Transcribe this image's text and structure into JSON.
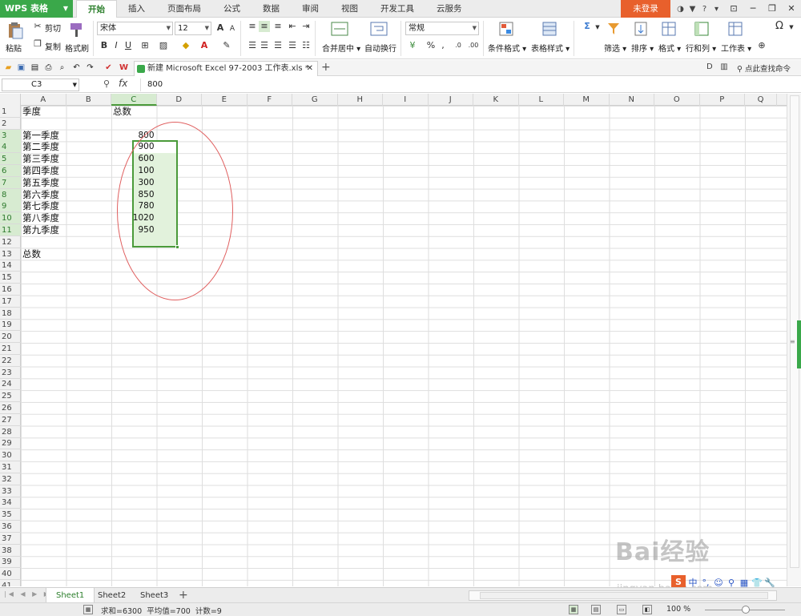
{
  "app": {
    "name": "WPS 表格",
    "login": "未登录"
  },
  "menu_tabs": [
    "开始",
    "插入",
    "页面布局",
    "公式",
    "数据",
    "审阅",
    "视图",
    "开发工具",
    "云服务"
  ],
  "ribbon": {
    "paste": "粘贴",
    "cut": "剪切",
    "copy": "复制",
    "format_painter": "格式刷",
    "font_name": "宋体",
    "font_size": "12",
    "bold": "B",
    "italic": "I",
    "underline": "U",
    "merge_center": "合并居中",
    "wrap_text": "自动换行",
    "number_format": "常规",
    "conditional_format": "条件格式",
    "table_style": "表格样式",
    "sum_symbol": "Σ",
    "filter": "筛选",
    "sort": "排序",
    "format": "格式",
    "row_col": "行和列",
    "worksheet": "工作表",
    "symbol": "Ω"
  },
  "document_tab": {
    "title": "新建 Microsoft Excel 97-2003 工作表.xls *"
  },
  "quickbar": {
    "cmd_search": "点此查找命令"
  },
  "formula_bar": {
    "name_box": "C3",
    "fx_label": "fx",
    "value": "800"
  },
  "columns": [
    "A",
    "B",
    "C",
    "D",
    "E",
    "F",
    "G",
    "H",
    "I",
    "J",
    "K",
    "L",
    "M",
    "N",
    "O",
    "P",
    "Q"
  ],
  "row_count": 41,
  "cells": {
    "A1": "季度",
    "C1": "总数",
    "A3": "第一季度",
    "A4": "第二季度",
    "A5": "第三季度",
    "A6": "第四季度",
    "A7": "第五季度",
    "A8": "第六季度",
    "A9": "第七季度",
    "A10": "第八季度",
    "A11": "第九季度",
    "C3": "800",
    "C4": "900",
    "C5": "600",
    "C6": "100",
    "C7": "300",
    "C8": "850",
    "C9": "780",
    "C10": "1020",
    "C11": "950",
    "A13": "总数"
  },
  "sheets": [
    "Sheet1",
    "Sheet2",
    "Sheet3"
  ],
  "active_sheet": "Sheet1",
  "status": {
    "sum": "求和=6300",
    "average": "平均值=700",
    "count": "计数=9",
    "zoom": "100 %"
  },
  "watermark": {
    "brand": "Bai经验",
    "url": "jingyan.baidu.com"
  },
  "ime_labels": [
    "中",
    "°,",
    "☺",
    "⚲",
    "▦",
    "👕",
    "🔧"
  ],
  "colors": {
    "accent": "#3aa84a",
    "selection_fill": "#e2f2dc",
    "login_bg": "#e8602c",
    "annotation_circle": "#e06060"
  }
}
